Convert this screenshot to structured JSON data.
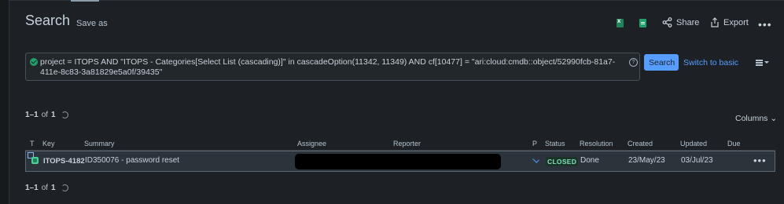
{
  "header": {
    "title": "Search",
    "save_as": "Save as",
    "excel_icon": "excel-file-icon",
    "doc_icon": "document-icon",
    "share": "Share",
    "export": "Export",
    "more": "•••"
  },
  "jql": {
    "query": "project = ITOPS AND \"ITOPS - Categories[Select List (cascading)]\" in cascadeOption(11342, 11349) AND cf[10477] = \"ari:cloud:cmdb::object/52990fcb-81a7-411e-8c83-3a81829e5a0f/39435\"",
    "help": "?",
    "search_button": "Search",
    "switch_basic": "Switch to basic"
  },
  "results": {
    "range": "1–1",
    "of_label": "of",
    "total": "1",
    "columns_button": "Columns",
    "headers": [
      "T",
      "Key",
      "Summary",
      "Assignee",
      "Reporter",
      "P",
      "Status",
      "Resolution",
      "Created",
      "Updated",
      "Due"
    ],
    "rows": [
      {
        "key": "ITOPS-4182",
        "summary": "ID350076 - password reset",
        "status": "CLOSED",
        "resolution": "Done",
        "created": "23/May/23",
        "updated": "03/Jul/23",
        "actions": "•••"
      }
    ]
  },
  "colors": {
    "background": "#1d2125",
    "accent": "#579dff",
    "status_closed": "#7ee2b8"
  }
}
